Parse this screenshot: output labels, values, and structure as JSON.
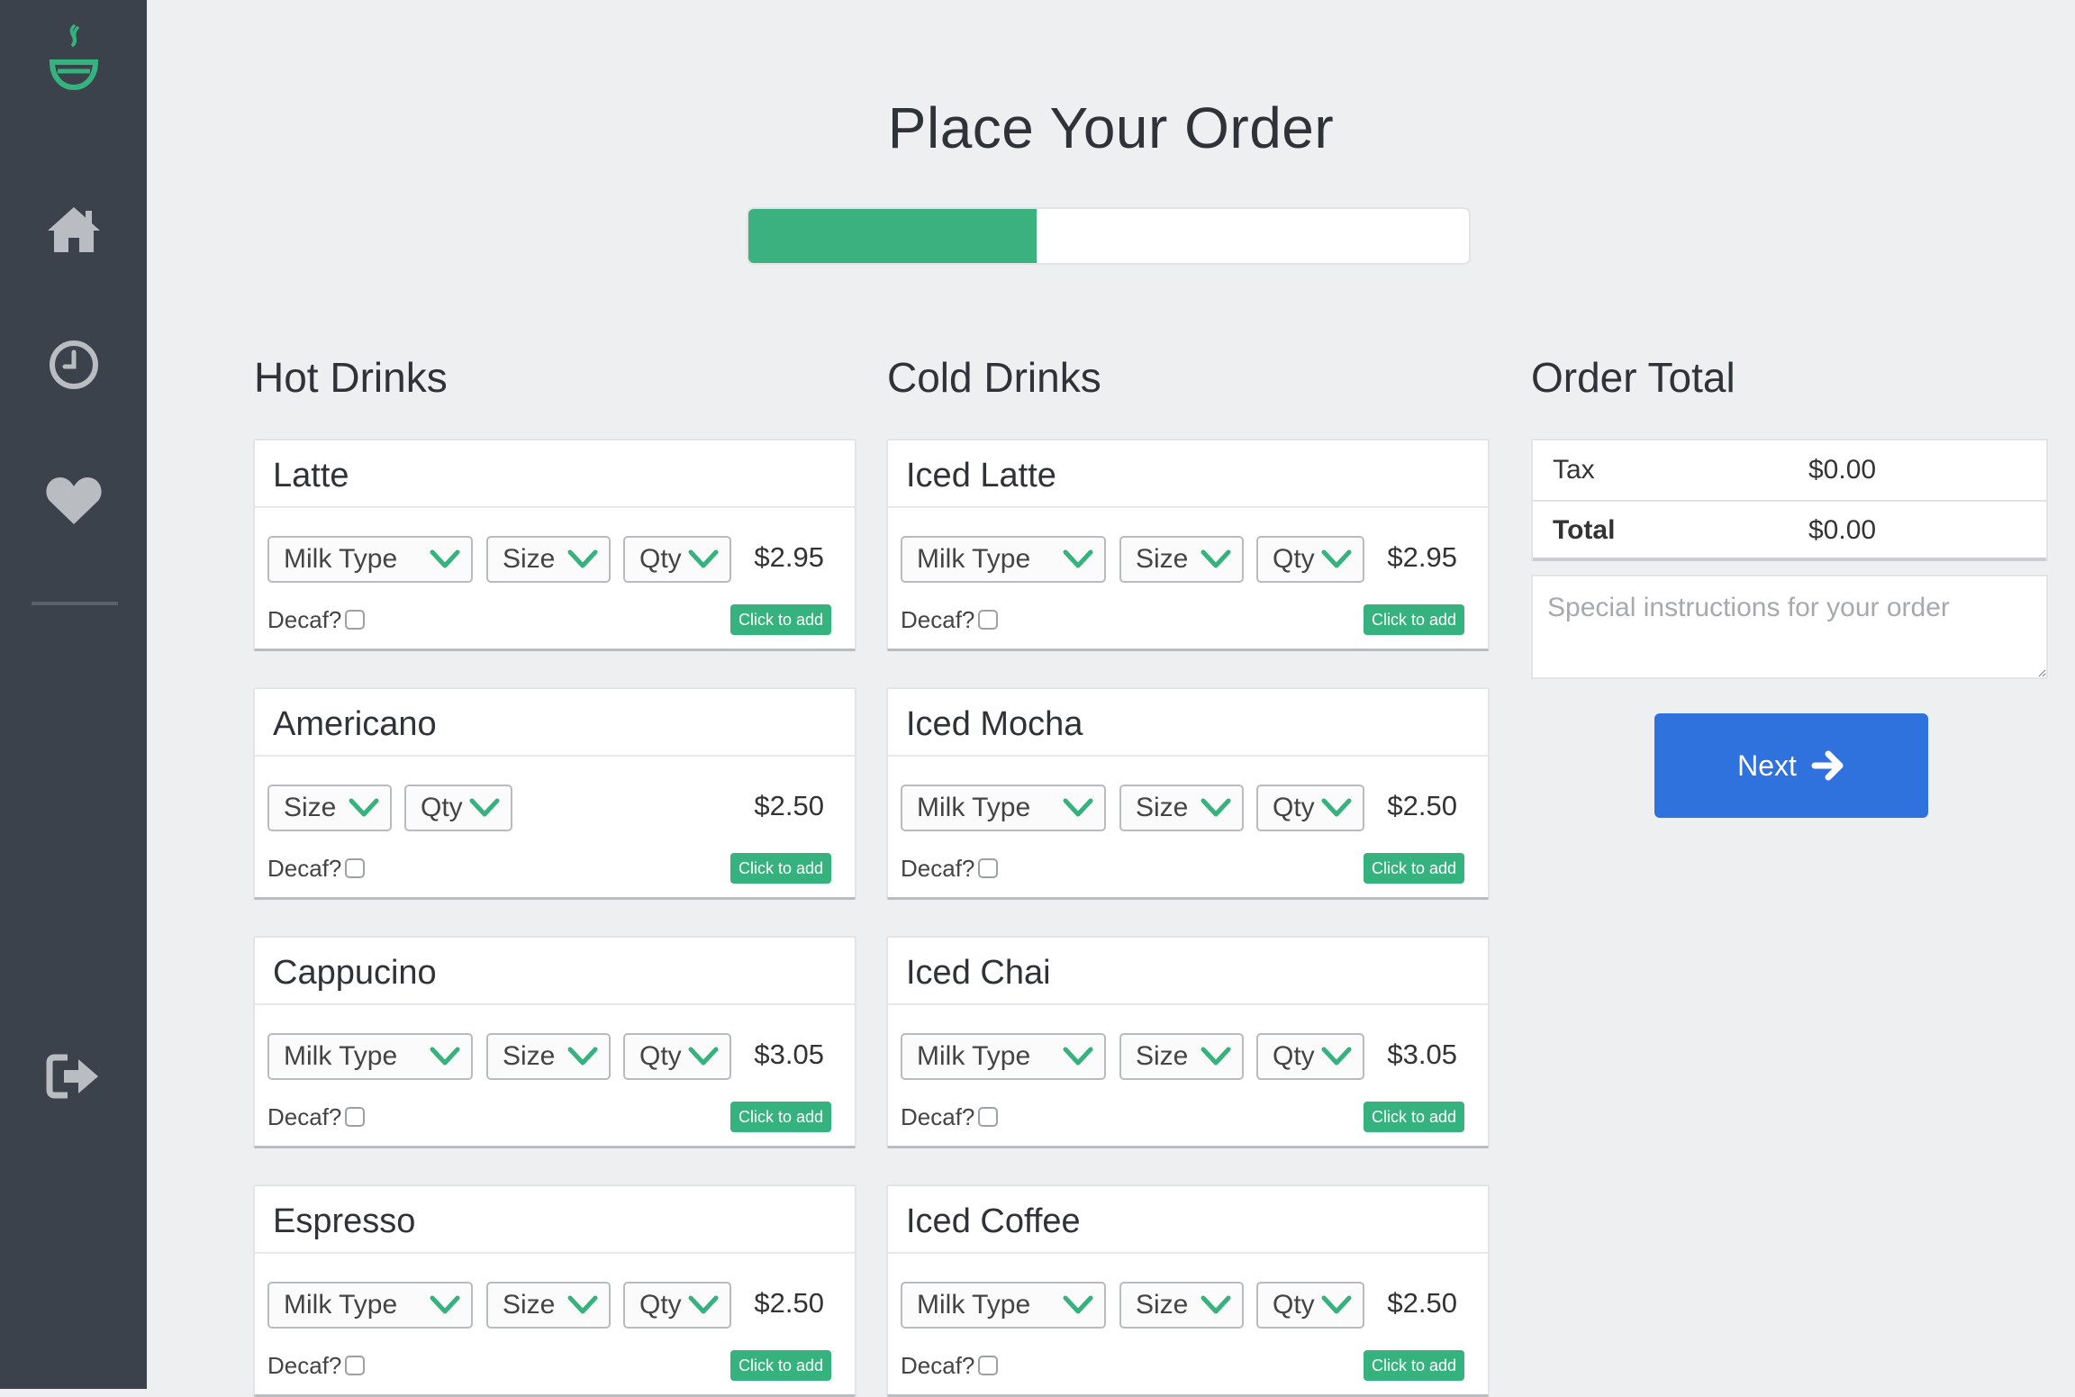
{
  "sidebar": {
    "icons": [
      "cup-logo-icon",
      "home-icon",
      "history-icon",
      "heart-icon",
      "logout-icon"
    ]
  },
  "page": {
    "title": "Place Your Order",
    "progress": 0.4
  },
  "hot_drinks": {
    "title": "Hot Drinks",
    "items": [
      {
        "name": "Latte",
        "milk": "Milk Type",
        "size": "Size",
        "qty": "Qty",
        "price": "$2.95",
        "decaf": "Decaf?",
        "add": "Click to add"
      },
      {
        "name": "Americano",
        "size": "Size",
        "qty": "Qty",
        "price": "$2.50",
        "decaf": "Decaf?",
        "add": "Click to add"
      },
      {
        "name": "Cappucino",
        "milk": "Milk Type",
        "size": "Size",
        "qty": "Qty",
        "price": "$3.05",
        "decaf": "Decaf?",
        "add": "Click to add"
      },
      {
        "name": "Espresso",
        "milk": "Milk Type",
        "size": "Size",
        "qty": "Qty",
        "price": "$2.50",
        "decaf": "Decaf?",
        "add": "Click to add"
      }
    ]
  },
  "cold_drinks": {
    "title": "Cold Drinks",
    "items": [
      {
        "name": "Iced Latte",
        "milk": "Milk Type",
        "size": "Size",
        "qty": "Qty",
        "price": "$2.95",
        "decaf": "Decaf?",
        "add": "Click to add"
      },
      {
        "name": "Iced Mocha",
        "milk": "Milk Type",
        "size": "Size",
        "qty": "Qty",
        "price": "$2.50",
        "decaf": "Decaf?",
        "add": "Click to add"
      },
      {
        "name": "Iced Chai",
        "milk": "Milk Type",
        "size": "Size",
        "qty": "Qty",
        "price": "$3.05",
        "decaf": "Decaf?",
        "add": "Click to add"
      },
      {
        "name": "Iced Coffee",
        "milk": "Milk Type",
        "size": "Size",
        "qty": "Qty",
        "price": "$2.50",
        "decaf": "Decaf?",
        "add": "Click to add"
      }
    ]
  },
  "order": {
    "title": "Order Total",
    "tax_label": "Tax",
    "tax_value": "$0.00",
    "total_label": "Total",
    "total_value": "$0.00",
    "notes_placeholder": "Special instructions for your order",
    "next_label": "Next"
  },
  "colors": {
    "accent_green": "#36b27e",
    "sidebar_bg": "#3c424c",
    "next_blue": "#2f72de"
  }
}
